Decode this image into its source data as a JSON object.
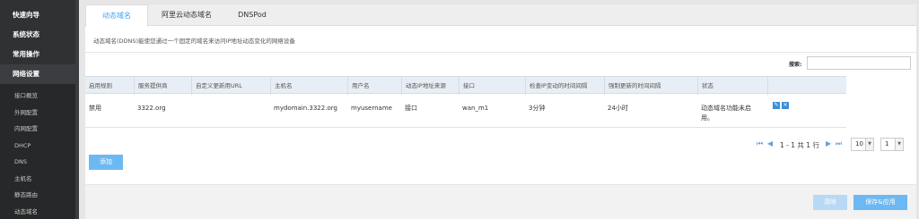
{
  "sidebar": {
    "main_items": [
      "快速向导",
      "系统状态",
      "常用操作",
      "网络设置"
    ],
    "sub_items": [
      "接口概览",
      "外网配置",
      "内网配置",
      "DHCP",
      "DNS",
      "主机名",
      "静态路由",
      "动态域名"
    ]
  },
  "tabs": [
    "动态域名",
    "阿里云动态域名",
    "DNSPod"
  ],
  "description": "动态域名(DDNS)能使您通过一个固定的域名来访问IP地址动态变化的网络设备",
  "search": {
    "label": "搜索:",
    "value": ""
  },
  "table": {
    "columns": [
      "启用规则",
      "服务提供商",
      "自定义更新用URL",
      "主机名",
      "用户名",
      "动态IP地址来源",
      "接口",
      "检查IP变动的时间间隔",
      "强制更新的时间间隔",
      "状态"
    ],
    "rows": [
      {
        "enable": "禁用",
        "provider": "3322.org",
        "custom_url": "",
        "hostname": "mydomain.3322.org",
        "username": "myusername",
        "ip_source": "接口",
        "interface": "wan_m1",
        "check_interval": "3分钟",
        "force_interval": "24小时",
        "status_line1": "动态域名功能未启",
        "status_line2": "用。"
      }
    ]
  },
  "pagination": {
    "info": "1 - 1 共 1 行",
    "page_size": "10",
    "page": "1"
  },
  "buttons": {
    "add": "添加",
    "clear": "清除",
    "save": "保存&应用"
  },
  "icons": {
    "edit": "pencil-icon",
    "delete": "close-icon"
  },
  "colors": {
    "accent": "#3e9ff0",
    "sidebar_bg": "#2f3133",
    "button": "#6cb8f2"
  }
}
